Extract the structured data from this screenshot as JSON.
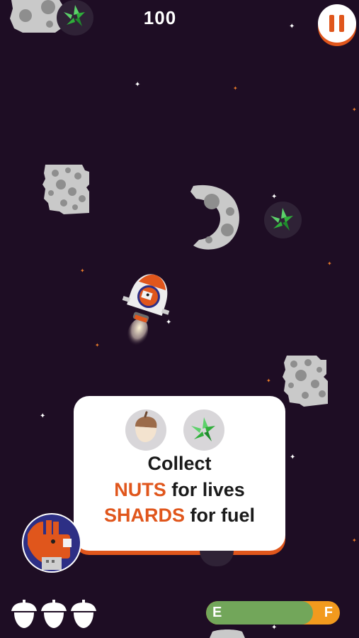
{
  "hud": {
    "score": "100",
    "pause_icon": "pause-icon",
    "lives_remaining": 3,
    "life_icon": "acorn-outline-icon"
  },
  "tooltip": {
    "icons": [
      "acorn-icon",
      "green-shard-icon"
    ],
    "line1": "Collect",
    "line2_highlight": "NUTS",
    "line2_rest": " for lives",
    "line3_highlight": "SHARDS",
    "line3_rest": " for fuel"
  },
  "fuel_gauge": {
    "empty_label": "E",
    "full_label": "F",
    "level": 0.8
  },
  "colors": {
    "background": "#1e0d24",
    "accent": "#e0561c",
    "fuel_green": "#72a65a",
    "fuel_orange": "#f29a1e",
    "shard_green": "#2fae3a",
    "asteroid": "#c9c9c9"
  },
  "character": {
    "avatar_icon": "kangaroo-pilot-icon",
    "ship_icon": "rocket-pod-icon"
  }
}
